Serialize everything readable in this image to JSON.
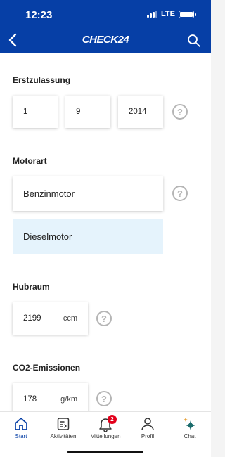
{
  "status_bar": {
    "time": "12:23",
    "network": "LTE",
    "icons": [
      "signal-icon",
      "battery-icon"
    ]
  },
  "header": {
    "logo": "CHECK24",
    "back_icon": "chevron-left-icon",
    "search_icon": "search-icon",
    "bg_color": "#063fa6"
  },
  "sections": {
    "erstzulassung": {
      "title": "Erstzulassung",
      "day": "1",
      "month": "9",
      "year": "2014",
      "help": "?"
    },
    "motorart": {
      "title": "Motorart",
      "options": [
        "Benzinmotor",
        "Dieselmotor"
      ],
      "selected": "Dieselmotor",
      "help": "?"
    },
    "hubraum": {
      "title": "Hubraum",
      "value": "2199",
      "unit": "ccm",
      "help": "?"
    },
    "co2": {
      "title": "CO2-Emissionen",
      "value": "178",
      "unit": "g/km",
      "help": "?"
    }
  },
  "tabbar": {
    "items": [
      {
        "label": "Start",
        "icon": "home-icon",
        "active": true
      },
      {
        "label": "Aktivitäten",
        "icon": "activity-icon",
        "active": false
      },
      {
        "label": "Mitteilungen",
        "icon": "bell-icon",
        "active": false,
        "badge": "2"
      },
      {
        "label": "Profil",
        "icon": "profile-icon",
        "active": false
      },
      {
        "label": "Chat",
        "icon": "sparkle-icon",
        "active": false
      }
    ]
  }
}
